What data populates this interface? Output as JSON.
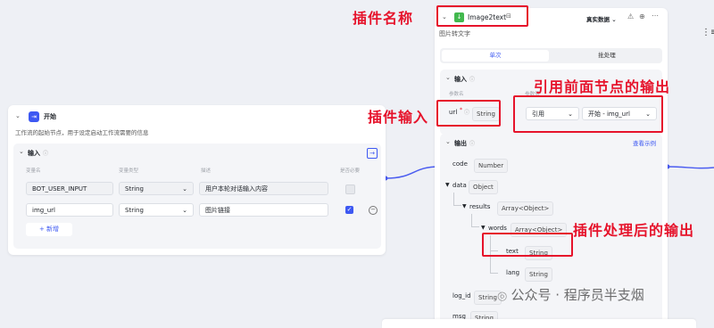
{
  "colors": {
    "accent": "#3d58f2",
    "annotation": "#e6132b",
    "connector": "#4a5cf0"
  },
  "start_node": {
    "title": "开始",
    "description": "工作流的起始节点，用于设定启动工作流需要的信息",
    "input_section_title": "输入",
    "columns": [
      "变量名",
      "变量类型",
      "描述",
      "是否必要"
    ],
    "rows": [
      {
        "name": "BOT_USER_INPUT",
        "type": "String",
        "desc": "用户本轮对话输入内容"
      },
      {
        "name": "img_url",
        "type": "String",
        "desc": "图片链接"
      }
    ],
    "add_button": "新增"
  },
  "plugin_node": {
    "title": "Image2text",
    "env_select": "真实数据",
    "description": "图片转文字",
    "tabs": [
      "单次",
      "批处理"
    ],
    "input_section_title": "输入",
    "input_header_param": "参数名",
    "input_header_value": "参数值",
    "param_name": "url",
    "param_type": "String",
    "ref_mode": "引用",
    "ref_value": "开始 - img_url",
    "output_section_title": "输出",
    "view_example": "查看示例",
    "outputs": {
      "code": {
        "name": "code",
        "type": "Number"
      },
      "data": {
        "name": "data",
        "type": "Object"
      },
      "results": {
        "name": "results",
        "type": "Array<Object>"
      },
      "words": {
        "name": "words",
        "type": "Array<Object>"
      },
      "text": {
        "name": "text",
        "type": "String"
      },
      "lang": {
        "name": "lang",
        "type": "String"
      },
      "log_id": {
        "name": "log_id",
        "type": "String"
      },
      "msg": {
        "name": "msg",
        "type": "String"
      }
    }
  },
  "annotations": {
    "plugin_name": "插件名称",
    "plugin_input": "插件输入",
    "reference_output": "引用前面节点的输出",
    "processed_output": "插件处理后的输出"
  },
  "watermark": "公众号 · 程序员半支烟"
}
